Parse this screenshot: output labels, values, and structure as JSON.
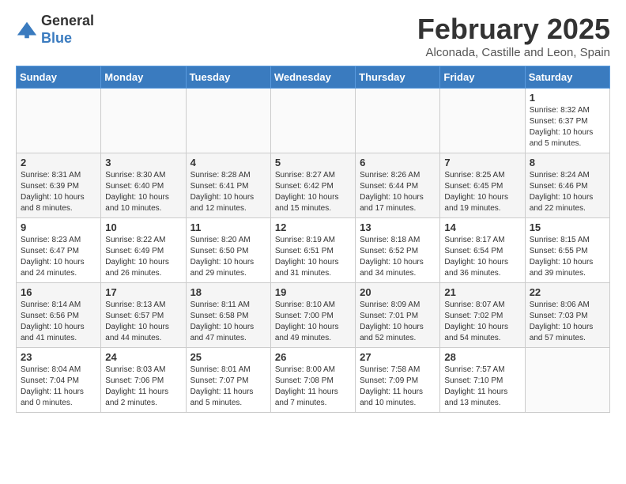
{
  "logo": {
    "general": "General",
    "blue": "Blue"
  },
  "title": "February 2025",
  "location": "Alconada, Castille and Leon, Spain",
  "days_of_week": [
    "Sunday",
    "Monday",
    "Tuesday",
    "Wednesday",
    "Thursday",
    "Friday",
    "Saturday"
  ],
  "weeks": [
    [
      {
        "day": "",
        "info": ""
      },
      {
        "day": "",
        "info": ""
      },
      {
        "day": "",
        "info": ""
      },
      {
        "day": "",
        "info": ""
      },
      {
        "day": "",
        "info": ""
      },
      {
        "day": "",
        "info": ""
      },
      {
        "day": "1",
        "info": "Sunrise: 8:32 AM\nSunset: 6:37 PM\nDaylight: 10 hours\nand 5 minutes."
      }
    ],
    [
      {
        "day": "2",
        "info": "Sunrise: 8:31 AM\nSunset: 6:39 PM\nDaylight: 10 hours\nand 8 minutes."
      },
      {
        "day": "3",
        "info": "Sunrise: 8:30 AM\nSunset: 6:40 PM\nDaylight: 10 hours\nand 10 minutes."
      },
      {
        "day": "4",
        "info": "Sunrise: 8:28 AM\nSunset: 6:41 PM\nDaylight: 10 hours\nand 12 minutes."
      },
      {
        "day": "5",
        "info": "Sunrise: 8:27 AM\nSunset: 6:42 PM\nDaylight: 10 hours\nand 15 minutes."
      },
      {
        "day": "6",
        "info": "Sunrise: 8:26 AM\nSunset: 6:44 PM\nDaylight: 10 hours\nand 17 minutes."
      },
      {
        "day": "7",
        "info": "Sunrise: 8:25 AM\nSunset: 6:45 PM\nDaylight: 10 hours\nand 19 minutes."
      },
      {
        "day": "8",
        "info": "Sunrise: 8:24 AM\nSunset: 6:46 PM\nDaylight: 10 hours\nand 22 minutes."
      }
    ],
    [
      {
        "day": "9",
        "info": "Sunrise: 8:23 AM\nSunset: 6:47 PM\nDaylight: 10 hours\nand 24 minutes."
      },
      {
        "day": "10",
        "info": "Sunrise: 8:22 AM\nSunset: 6:49 PM\nDaylight: 10 hours\nand 26 minutes."
      },
      {
        "day": "11",
        "info": "Sunrise: 8:20 AM\nSunset: 6:50 PM\nDaylight: 10 hours\nand 29 minutes."
      },
      {
        "day": "12",
        "info": "Sunrise: 8:19 AM\nSunset: 6:51 PM\nDaylight: 10 hours\nand 31 minutes."
      },
      {
        "day": "13",
        "info": "Sunrise: 8:18 AM\nSunset: 6:52 PM\nDaylight: 10 hours\nand 34 minutes."
      },
      {
        "day": "14",
        "info": "Sunrise: 8:17 AM\nSunset: 6:54 PM\nDaylight: 10 hours\nand 36 minutes."
      },
      {
        "day": "15",
        "info": "Sunrise: 8:15 AM\nSunset: 6:55 PM\nDaylight: 10 hours\nand 39 minutes."
      }
    ],
    [
      {
        "day": "16",
        "info": "Sunrise: 8:14 AM\nSunset: 6:56 PM\nDaylight: 10 hours\nand 41 minutes."
      },
      {
        "day": "17",
        "info": "Sunrise: 8:13 AM\nSunset: 6:57 PM\nDaylight: 10 hours\nand 44 minutes."
      },
      {
        "day": "18",
        "info": "Sunrise: 8:11 AM\nSunset: 6:58 PM\nDaylight: 10 hours\nand 47 minutes."
      },
      {
        "day": "19",
        "info": "Sunrise: 8:10 AM\nSunset: 7:00 PM\nDaylight: 10 hours\nand 49 minutes."
      },
      {
        "day": "20",
        "info": "Sunrise: 8:09 AM\nSunset: 7:01 PM\nDaylight: 10 hours\nand 52 minutes."
      },
      {
        "day": "21",
        "info": "Sunrise: 8:07 AM\nSunset: 7:02 PM\nDaylight: 10 hours\nand 54 minutes."
      },
      {
        "day": "22",
        "info": "Sunrise: 8:06 AM\nSunset: 7:03 PM\nDaylight: 10 hours\nand 57 minutes."
      }
    ],
    [
      {
        "day": "23",
        "info": "Sunrise: 8:04 AM\nSunset: 7:04 PM\nDaylight: 11 hours\nand 0 minutes."
      },
      {
        "day": "24",
        "info": "Sunrise: 8:03 AM\nSunset: 7:06 PM\nDaylight: 11 hours\nand 2 minutes."
      },
      {
        "day": "25",
        "info": "Sunrise: 8:01 AM\nSunset: 7:07 PM\nDaylight: 11 hours\nand 5 minutes."
      },
      {
        "day": "26",
        "info": "Sunrise: 8:00 AM\nSunset: 7:08 PM\nDaylight: 11 hours\nand 7 minutes."
      },
      {
        "day": "27",
        "info": "Sunrise: 7:58 AM\nSunset: 7:09 PM\nDaylight: 11 hours\nand 10 minutes."
      },
      {
        "day": "28",
        "info": "Sunrise: 7:57 AM\nSunset: 7:10 PM\nDaylight: 11 hours\nand 13 minutes."
      },
      {
        "day": "",
        "info": ""
      }
    ]
  ]
}
